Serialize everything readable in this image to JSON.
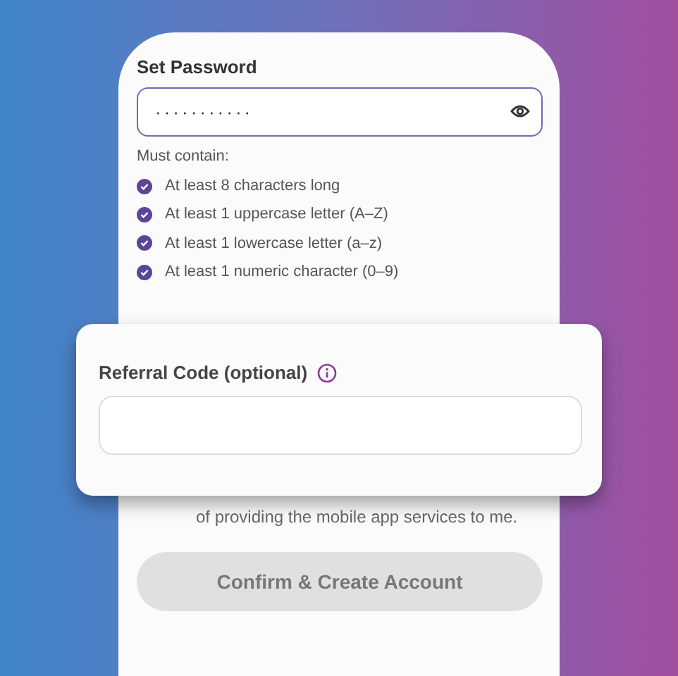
{
  "password": {
    "label": "Set Password",
    "value": "···········",
    "requirements_title": "Must contain:",
    "requirements": [
      {
        "text": "At least 8 characters long",
        "checked": true
      },
      {
        "text": "At least 1 uppercase letter (A–Z)",
        "checked": true
      },
      {
        "text": "At least 1 lowercase letter (a–z)",
        "checked": true
      },
      {
        "text": "At least 1 numeric character (0–9)",
        "checked": true
      }
    ]
  },
  "consent_text": "of providing the mobile app services to me.",
  "submit": {
    "label": "Confirm & Create Account",
    "disabled": true
  },
  "referral": {
    "label": "Referral Code (optional)"
  }
}
